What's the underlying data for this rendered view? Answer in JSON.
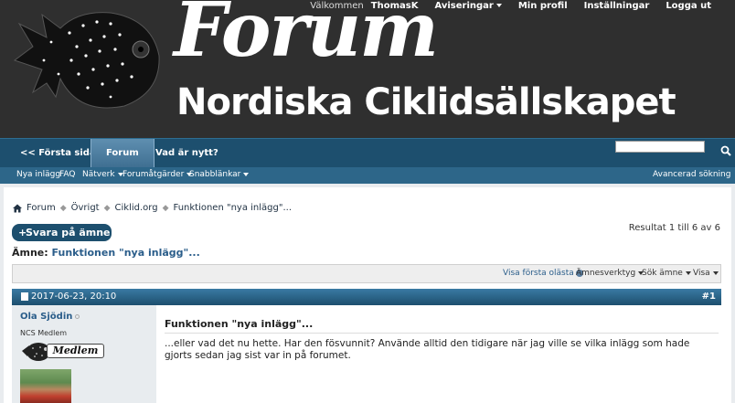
{
  "header": {
    "brand_title": "Forum",
    "brand_subtitle": "Nordiska Ciklidsällskapet",
    "welcome": "Välkommen",
    "username": "ThomasK",
    "notifications": "Aviseringar",
    "profile": "Min profil",
    "settings": "Inställningar",
    "logout": "Logga ut"
  },
  "nav": {
    "home": "<< Första sidan",
    "forum": "Forum",
    "whats_new": "Vad är nytt?",
    "search_placeholder": ""
  },
  "subnav": {
    "new_posts": "Nya inlägg",
    "faq": "FAQ",
    "network": "Nätverk",
    "forum_actions": "Forumåtgärder",
    "quick_links": "Snabblänkar",
    "advanced_search": "Avancerad sökning"
  },
  "breadcrumb": [
    "Forum",
    "Övrigt",
    "Ciklid.org",
    "Funktionen \"nya inlägg\"..."
  ],
  "reply_button": "Svara på ämne",
  "results": "Resultat 1 till 6 av 6",
  "thread": {
    "prefix": "Ämne:",
    "title": "Funktionen \"nya inlägg\"..."
  },
  "tools": {
    "first_unread": "Visa första olästa",
    "thread_tools": "Ämnesverktyg",
    "search_thread": "Sök ämne",
    "display": "Visa"
  },
  "post": {
    "date": "2017-06-23, 20:10",
    "number": "#1",
    "author": "Ola Sjödin",
    "user_title": "NCS Medlem",
    "rank": "Medlem",
    "title": "Funktionen \"nya inlägg\"...",
    "text": "...eller vad det nu hette. Har den fösvunnit? Använde alltid den tidigare när jag ville se vilka inlägg som hade gjorts sedan jag sist var in på forumet."
  },
  "colors": {
    "header_bg": "#2f2f2f",
    "nav_bg": "#1d4f6e",
    "subnav_bg": "#2d6689",
    "link": "#2a5d8a"
  }
}
